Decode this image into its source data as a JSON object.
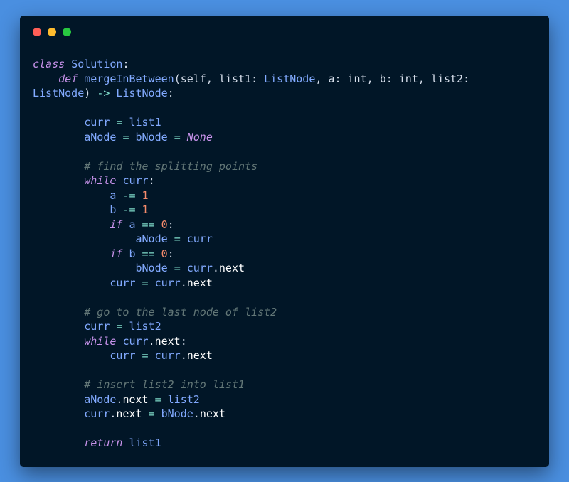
{
  "window": {
    "controls": [
      {
        "name": "close",
        "color": "#ff5f57"
      },
      {
        "name": "minimize",
        "color": "#febc2e"
      },
      {
        "name": "maximize",
        "color": "#28c840"
      }
    ]
  },
  "colors": {
    "page_background": "#4a8fe0",
    "editor_background": "#011627",
    "keyword": "#c792ea",
    "identifier": "#82aaff",
    "operator": "#7fdbca",
    "number": "#f78c6c",
    "comment": "#637777",
    "property": "#ffffff"
  },
  "code": {
    "lines": [
      [
        {
          "t": "kw",
          "v": "class"
        },
        {
          "t": "sp",
          "v": " "
        },
        {
          "t": "cls",
          "v": "Solution"
        },
        {
          "t": "pu",
          "v": ":"
        }
      ],
      [
        {
          "t": "sp",
          "v": "    "
        },
        {
          "t": "kw",
          "v": "def"
        },
        {
          "t": "sp",
          "v": " "
        },
        {
          "t": "fn",
          "v": "mergeInBetween"
        },
        {
          "t": "pu",
          "v": "("
        },
        {
          "t": "pa",
          "v": "self"
        },
        {
          "t": "pu",
          "v": ", "
        },
        {
          "t": "pa",
          "v": "list1"
        },
        {
          "t": "pu",
          "v": ": "
        },
        {
          "t": "ty",
          "v": "ListNode"
        },
        {
          "t": "pu",
          "v": ", "
        },
        {
          "t": "pa",
          "v": "a"
        },
        {
          "t": "pu",
          "v": ": "
        },
        {
          "t": "pa",
          "v": "int"
        },
        {
          "t": "pu",
          "v": ", "
        },
        {
          "t": "pa",
          "v": "b"
        },
        {
          "t": "pu",
          "v": ": "
        },
        {
          "t": "pa",
          "v": "int"
        },
        {
          "t": "pu",
          "v": ", "
        },
        {
          "t": "pa",
          "v": "list2"
        },
        {
          "t": "pu",
          "v": ":"
        }
      ],
      [
        {
          "t": "ty",
          "v": "ListNode"
        },
        {
          "t": "pu",
          "v": ") "
        },
        {
          "t": "op",
          "v": "->"
        },
        {
          "t": "sp",
          "v": " "
        },
        {
          "t": "ty",
          "v": "ListNode"
        },
        {
          "t": "pu",
          "v": ":"
        }
      ],
      [],
      [
        {
          "t": "sp",
          "v": "        "
        },
        {
          "t": "id",
          "v": "curr"
        },
        {
          "t": "sp",
          "v": " "
        },
        {
          "t": "op",
          "v": "="
        },
        {
          "t": "sp",
          "v": " "
        },
        {
          "t": "id",
          "v": "list1"
        }
      ],
      [
        {
          "t": "sp",
          "v": "        "
        },
        {
          "t": "id",
          "v": "aNode"
        },
        {
          "t": "sp",
          "v": " "
        },
        {
          "t": "op",
          "v": "="
        },
        {
          "t": "sp",
          "v": " "
        },
        {
          "t": "id",
          "v": "bNode"
        },
        {
          "t": "sp",
          "v": " "
        },
        {
          "t": "op",
          "v": "="
        },
        {
          "t": "sp",
          "v": " "
        },
        {
          "t": "nn",
          "v": "None"
        }
      ],
      [],
      [
        {
          "t": "sp",
          "v": "        "
        },
        {
          "t": "cm",
          "v": "# find the splitting points"
        }
      ],
      [
        {
          "t": "sp",
          "v": "        "
        },
        {
          "t": "kw",
          "v": "while"
        },
        {
          "t": "sp",
          "v": " "
        },
        {
          "t": "id",
          "v": "curr"
        },
        {
          "t": "pu",
          "v": ":"
        }
      ],
      [
        {
          "t": "sp",
          "v": "            "
        },
        {
          "t": "id",
          "v": "a"
        },
        {
          "t": "sp",
          "v": " "
        },
        {
          "t": "op",
          "v": "-="
        },
        {
          "t": "sp",
          "v": " "
        },
        {
          "t": "nu",
          "v": "1"
        }
      ],
      [
        {
          "t": "sp",
          "v": "            "
        },
        {
          "t": "id",
          "v": "b"
        },
        {
          "t": "sp",
          "v": " "
        },
        {
          "t": "op",
          "v": "-="
        },
        {
          "t": "sp",
          "v": " "
        },
        {
          "t": "nu",
          "v": "1"
        }
      ],
      [
        {
          "t": "sp",
          "v": "            "
        },
        {
          "t": "kw",
          "v": "if"
        },
        {
          "t": "sp",
          "v": " "
        },
        {
          "t": "id",
          "v": "a"
        },
        {
          "t": "sp",
          "v": " "
        },
        {
          "t": "op",
          "v": "=="
        },
        {
          "t": "sp",
          "v": " "
        },
        {
          "t": "nu",
          "v": "0"
        },
        {
          "t": "pu",
          "v": ":"
        }
      ],
      [
        {
          "t": "sp",
          "v": "                "
        },
        {
          "t": "id",
          "v": "aNode"
        },
        {
          "t": "sp",
          "v": " "
        },
        {
          "t": "op",
          "v": "="
        },
        {
          "t": "sp",
          "v": " "
        },
        {
          "t": "id",
          "v": "curr"
        }
      ],
      [
        {
          "t": "sp",
          "v": "            "
        },
        {
          "t": "kw",
          "v": "if"
        },
        {
          "t": "sp",
          "v": " "
        },
        {
          "t": "id",
          "v": "b"
        },
        {
          "t": "sp",
          "v": " "
        },
        {
          "t": "op",
          "v": "=="
        },
        {
          "t": "sp",
          "v": " "
        },
        {
          "t": "nu",
          "v": "0"
        },
        {
          "t": "pu",
          "v": ":"
        }
      ],
      [
        {
          "t": "sp",
          "v": "                "
        },
        {
          "t": "id",
          "v": "bNode"
        },
        {
          "t": "sp",
          "v": " "
        },
        {
          "t": "op",
          "v": "="
        },
        {
          "t": "sp",
          "v": " "
        },
        {
          "t": "id",
          "v": "curr"
        },
        {
          "t": "pu",
          "v": "."
        },
        {
          "t": "pr",
          "v": "next"
        }
      ],
      [
        {
          "t": "sp",
          "v": "            "
        },
        {
          "t": "id",
          "v": "curr"
        },
        {
          "t": "sp",
          "v": " "
        },
        {
          "t": "op",
          "v": "="
        },
        {
          "t": "sp",
          "v": " "
        },
        {
          "t": "id",
          "v": "curr"
        },
        {
          "t": "pu",
          "v": "."
        },
        {
          "t": "pr",
          "v": "next"
        }
      ],
      [],
      [
        {
          "t": "sp",
          "v": "        "
        },
        {
          "t": "cm",
          "v": "# go to the last node of list2"
        }
      ],
      [
        {
          "t": "sp",
          "v": "        "
        },
        {
          "t": "id",
          "v": "curr"
        },
        {
          "t": "sp",
          "v": " "
        },
        {
          "t": "op",
          "v": "="
        },
        {
          "t": "sp",
          "v": " "
        },
        {
          "t": "id",
          "v": "list2"
        }
      ],
      [
        {
          "t": "sp",
          "v": "        "
        },
        {
          "t": "kw",
          "v": "while"
        },
        {
          "t": "sp",
          "v": " "
        },
        {
          "t": "id",
          "v": "curr"
        },
        {
          "t": "pu",
          "v": "."
        },
        {
          "t": "pr",
          "v": "next"
        },
        {
          "t": "pu",
          "v": ":"
        }
      ],
      [
        {
          "t": "sp",
          "v": "            "
        },
        {
          "t": "id",
          "v": "curr"
        },
        {
          "t": "sp",
          "v": " "
        },
        {
          "t": "op",
          "v": "="
        },
        {
          "t": "sp",
          "v": " "
        },
        {
          "t": "id",
          "v": "curr"
        },
        {
          "t": "pu",
          "v": "."
        },
        {
          "t": "pr",
          "v": "next"
        }
      ],
      [],
      [
        {
          "t": "sp",
          "v": "        "
        },
        {
          "t": "cm",
          "v": "# insert list2 into list1"
        }
      ],
      [
        {
          "t": "sp",
          "v": "        "
        },
        {
          "t": "id",
          "v": "aNode"
        },
        {
          "t": "pu",
          "v": "."
        },
        {
          "t": "pr",
          "v": "next"
        },
        {
          "t": "sp",
          "v": " "
        },
        {
          "t": "op",
          "v": "="
        },
        {
          "t": "sp",
          "v": " "
        },
        {
          "t": "id",
          "v": "list2"
        }
      ],
      [
        {
          "t": "sp",
          "v": "        "
        },
        {
          "t": "id",
          "v": "curr"
        },
        {
          "t": "pu",
          "v": "."
        },
        {
          "t": "pr",
          "v": "next"
        },
        {
          "t": "sp",
          "v": " "
        },
        {
          "t": "op",
          "v": "="
        },
        {
          "t": "sp",
          "v": " "
        },
        {
          "t": "id",
          "v": "bNode"
        },
        {
          "t": "pu",
          "v": "."
        },
        {
          "t": "pr",
          "v": "next"
        }
      ],
      [],
      [
        {
          "t": "sp",
          "v": "        "
        },
        {
          "t": "kw",
          "v": "return"
        },
        {
          "t": "sp",
          "v": " "
        },
        {
          "t": "id",
          "v": "list1"
        }
      ]
    ]
  }
}
